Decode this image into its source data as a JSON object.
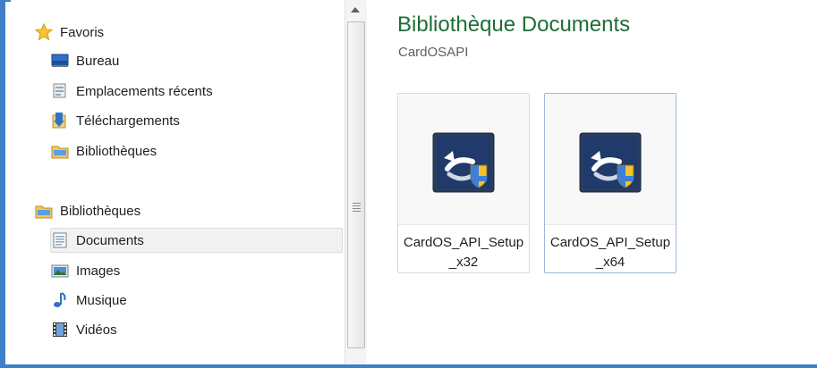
{
  "nav": {
    "favorites": {
      "label": "Favoris",
      "icon": "star-icon",
      "items": [
        {
          "label": "Bureau",
          "icon": "desktop-icon"
        },
        {
          "label": "Emplacements récents",
          "icon": "recent-places-icon"
        },
        {
          "label": "Téléchargements",
          "icon": "downloads-icon"
        },
        {
          "label": "Bibliothèques",
          "icon": "libraries-icon"
        }
      ]
    },
    "libraries": {
      "label": "Bibliothèques",
      "icon": "libraries-icon",
      "items": [
        {
          "label": "Documents",
          "icon": "documents-icon",
          "selected": true
        },
        {
          "label": "Images",
          "icon": "pictures-icon"
        },
        {
          "label": "Musique",
          "icon": "music-icon"
        },
        {
          "label": "Vidéos",
          "icon": "videos-icon"
        }
      ]
    }
  },
  "content": {
    "title": "Bibliothèque Documents",
    "subtitle": "CardOSAPI",
    "files": [
      {
        "name": "CardOS_API_Setup_x32",
        "icon": "installer-icon"
      },
      {
        "name": "CardOS_API_Setup_x64",
        "icon": "installer-icon"
      }
    ]
  },
  "colors": {
    "window_border": "#3f7fc8",
    "title": "#1e6e35"
  }
}
